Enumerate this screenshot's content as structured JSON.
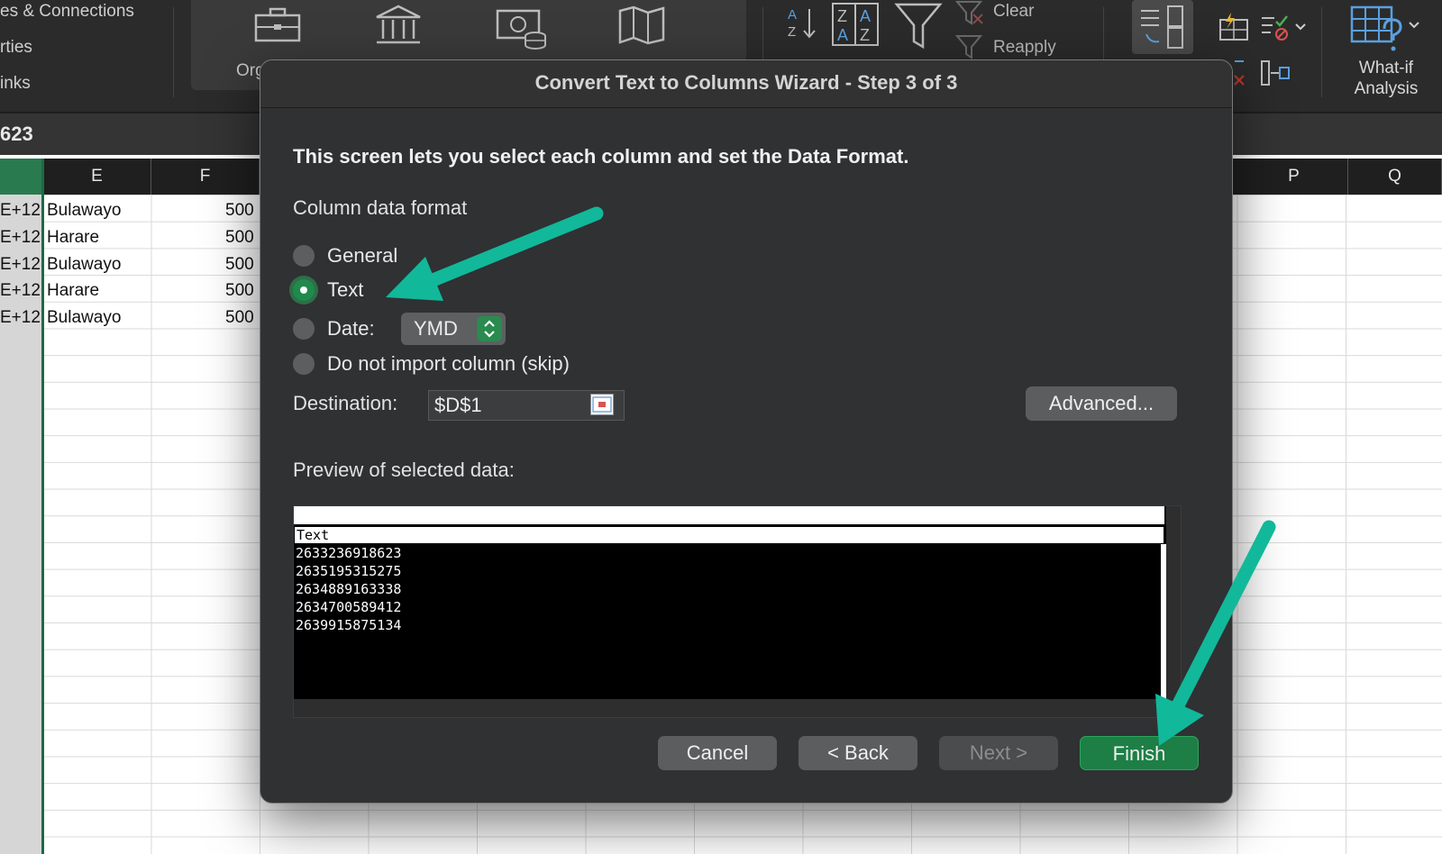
{
  "ribbon": {
    "connections_items": [
      "es & Connections",
      "rties",
      "inks"
    ],
    "data_types_label": "Org",
    "clear_label": "Clear",
    "reapply_label": "Reapply",
    "what_if_label_1": "What-if",
    "what_if_label_2": "Analysis"
  },
  "formula_bar": {
    "value": "623"
  },
  "columns": {
    "E": "E",
    "F": "F",
    "P": "P",
    "Q": "Q"
  },
  "sheet_rows": [
    {
      "d": "E+12",
      "e": "Bulawayo",
      "f": "500"
    },
    {
      "d": "E+12",
      "e": "Harare",
      "f": "500"
    },
    {
      "d": "E+12",
      "e": "Bulawayo",
      "f": "500"
    },
    {
      "d": "E+12",
      "e": "Harare",
      "f": "500"
    },
    {
      "d": "E+12",
      "e": "Bulawayo",
      "f": "500"
    }
  ],
  "dialog": {
    "title": "Convert Text to Columns Wizard - Step 3 of 3",
    "intro": "This screen lets you select each column and set the Data Format.",
    "column_format_label": "Column data format",
    "options": {
      "general": "General",
      "text": "Text",
      "date": "Date:",
      "skip": "Do not import column (skip)"
    },
    "selected_option": "Text",
    "date_format": "YMD",
    "destination_label": "Destination:",
    "destination_value": "$D$1",
    "advanced_label": "Advanced...",
    "preview_label": "Preview of selected data:",
    "preview_header": "Text",
    "preview_rows": [
      "2633236918623",
      "2635195315275",
      "2634889163338",
      "2634700589412",
      "2639915875134"
    ],
    "buttons": {
      "cancel": "Cancel",
      "back": "< Back",
      "next": "Next >",
      "finish": "Finish"
    }
  },
  "colors": {
    "accent_green": "#1d7f46",
    "annotation_arrow": "#12b89a"
  }
}
